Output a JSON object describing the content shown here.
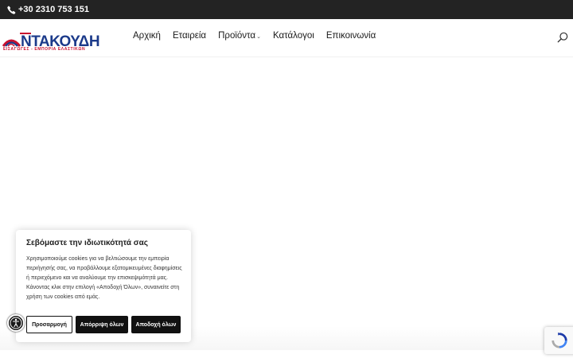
{
  "topbar": {
    "phone": "+30 2310 753 151",
    "phone_icon": "phone-icon"
  },
  "logo": {
    "name": "ΝΤΑΚΟΥΔΗ",
    "tagline": "ΕΙΣΑΓΩΓΕΣ - ΕΜΠΟΡΙΑ ΕΛΑΣΤΙΚΩΝ"
  },
  "nav": {
    "items": [
      {
        "label": "Αρχική"
      },
      {
        "label": "Εταιρεία"
      },
      {
        "label": "Προϊόντα",
        "has_dropdown": true
      },
      {
        "label": "Κατάλογοι"
      },
      {
        "label": "Επικοινωνία"
      }
    ],
    "search_icon": "search-icon"
  },
  "cookie": {
    "title": "Σεβόμαστε την ιδιωτικότητά σας",
    "text": "Χρησιμοποιούμε cookies για να βελτιώσουμε την εμπειρία περιήγησής σας, να προβάλλουμε εξατομικευμένες διαφημίσεις ή περιεχόμενο και να αναλύουμε την επισκεψιμότητά μας. Κάνοντας κλικ στην επιλογή «Αποδοχή Όλων», συναινείτε στη χρήση των cookies από εμάς.",
    "customize": "Προσαρμογή",
    "reject": "Απόρριψη όλων",
    "accept": "Αποδοχή όλων"
  },
  "colors": {
    "topbar": "#232323",
    "brand_red": "#c8102e",
    "brand_blue": "#1b3a8a",
    "button_dark": "#111111"
  }
}
